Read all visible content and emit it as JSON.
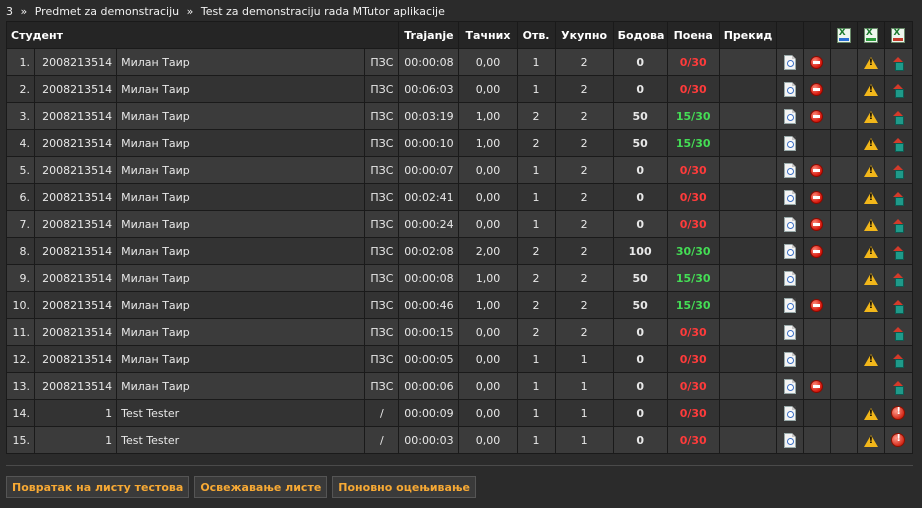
{
  "breadcrumb": {
    "items": [
      "3",
      "Predmet za demonstraciju",
      "Test za demonstraciju rada MTutor aplikacije"
    ],
    "separator": "»"
  },
  "table": {
    "headers": {
      "student": "Студент",
      "duration": "Trajanje",
      "correct": "Тачних",
      "answered": "Отв.",
      "total": "Укупно",
      "points": "Бодова",
      "score": "Поена",
      "interrupt": "Прекид"
    },
    "export_icons": [
      "excel-export-icon",
      "excel-export-icon",
      "excel-export-icon"
    ],
    "rows": [
      {
        "n": "1.",
        "id": "2008213514",
        "name": "Милан Таир",
        "group": "ПЗС",
        "time": "00:00:08",
        "correct": "0,00",
        "answered": "1",
        "total": "2",
        "points": "0",
        "score": "0/30",
        "pass": false,
        "stop": true,
        "warn": true,
        "end_icon": "home"
      },
      {
        "n": "2.",
        "id": "2008213514",
        "name": "Милан Таир",
        "group": "ПЗС",
        "time": "00:06:03",
        "correct": "0,00",
        "answered": "1",
        "total": "2",
        "points": "0",
        "score": "0/30",
        "pass": false,
        "stop": true,
        "warn": true,
        "end_icon": "home"
      },
      {
        "n": "3.",
        "id": "2008213514",
        "name": "Милан Таир",
        "group": "ПЗС",
        "time": "00:03:19",
        "correct": "1,00",
        "answered": "2",
        "total": "2",
        "points": "50",
        "score": "15/30",
        "pass": true,
        "stop": true,
        "warn": true,
        "end_icon": "home"
      },
      {
        "n": "4.",
        "id": "2008213514",
        "name": "Милан Таир",
        "group": "ПЗС",
        "time": "00:00:10",
        "correct": "1,00",
        "answered": "2",
        "total": "2",
        "points": "50",
        "score": "15/30",
        "pass": true,
        "stop": false,
        "warn": true,
        "end_icon": "home"
      },
      {
        "n": "5.",
        "id": "2008213514",
        "name": "Милан Таир",
        "group": "ПЗС",
        "time": "00:00:07",
        "correct": "0,00",
        "answered": "1",
        "total": "2",
        "points": "0",
        "score": "0/30",
        "pass": false,
        "stop": true,
        "warn": true,
        "end_icon": "home"
      },
      {
        "n": "6.",
        "id": "2008213514",
        "name": "Милан Таир",
        "group": "ПЗС",
        "time": "00:02:41",
        "correct": "0,00",
        "answered": "1",
        "total": "2",
        "points": "0",
        "score": "0/30",
        "pass": false,
        "stop": true,
        "warn": true,
        "end_icon": "home"
      },
      {
        "n": "7.",
        "id": "2008213514",
        "name": "Милан Таир",
        "group": "ПЗС",
        "time": "00:00:24",
        "correct": "0,00",
        "answered": "1",
        "total": "2",
        "points": "0",
        "score": "0/30",
        "pass": false,
        "stop": true,
        "warn": true,
        "end_icon": "home"
      },
      {
        "n": "8.",
        "id": "2008213514",
        "name": "Милан Таир",
        "group": "ПЗС",
        "time": "00:02:08",
        "correct": "2,00",
        "answered": "2",
        "total": "2",
        "points": "100",
        "score": "30/30",
        "pass": true,
        "stop": true,
        "warn": true,
        "end_icon": "home"
      },
      {
        "n": "9.",
        "id": "2008213514",
        "name": "Милан Таир",
        "group": "ПЗС",
        "time": "00:00:08",
        "correct": "1,00",
        "answered": "2",
        "total": "2",
        "points": "50",
        "score": "15/30",
        "pass": true,
        "stop": false,
        "warn": true,
        "end_icon": "home"
      },
      {
        "n": "10.",
        "id": "2008213514",
        "name": "Милан Таир",
        "group": "ПЗС",
        "time": "00:00:46",
        "correct": "1,00",
        "answered": "2",
        "total": "2",
        "points": "50",
        "score": "15/30",
        "pass": true,
        "stop": true,
        "warn": true,
        "end_icon": "home"
      },
      {
        "n": "11.",
        "id": "2008213514",
        "name": "Милан Таир",
        "group": "ПЗС",
        "time": "00:00:15",
        "correct": "0,00",
        "answered": "2",
        "total": "2",
        "points": "0",
        "score": "0/30",
        "pass": false,
        "stop": false,
        "warn": false,
        "end_icon": "home"
      },
      {
        "n": "12.",
        "id": "2008213514",
        "name": "Милан Таир",
        "group": "ПЗС",
        "time": "00:00:05",
        "correct": "0,00",
        "answered": "1",
        "total": "1",
        "points": "0",
        "score": "0/30",
        "pass": false,
        "stop": false,
        "warn": true,
        "end_icon": "home"
      },
      {
        "n": "13.",
        "id": "2008213514",
        "name": "Милан Таир",
        "group": "ПЗС",
        "time": "00:00:06",
        "correct": "0,00",
        "answered": "1",
        "total": "1",
        "points": "0",
        "score": "0/30",
        "pass": false,
        "stop": true,
        "warn": false,
        "end_icon": "home"
      },
      {
        "n": "14.",
        "id": "1",
        "name": "Test Tester",
        "group": "/",
        "time": "00:00:09",
        "correct": "0,00",
        "answered": "1",
        "total": "1",
        "points": "0",
        "score": "0/30",
        "pass": false,
        "stop": false,
        "warn": true,
        "end_icon": "alert"
      },
      {
        "n": "15.",
        "id": "1",
        "name": "Test Tester",
        "group": "/",
        "time": "00:00:03",
        "correct": "0,00",
        "answered": "1",
        "total": "1",
        "points": "0",
        "score": "0/30",
        "pass": false,
        "stop": false,
        "warn": true,
        "end_icon": "alert"
      }
    ]
  },
  "buttons": {
    "back": "Повратак на листу тестова",
    "refresh": "Освежавање листе",
    "regrade": "Поновно оцењивање"
  },
  "colors": {
    "fail": "#ff3b3b",
    "pass": "#44dd55",
    "button_text": "#f7a934"
  }
}
